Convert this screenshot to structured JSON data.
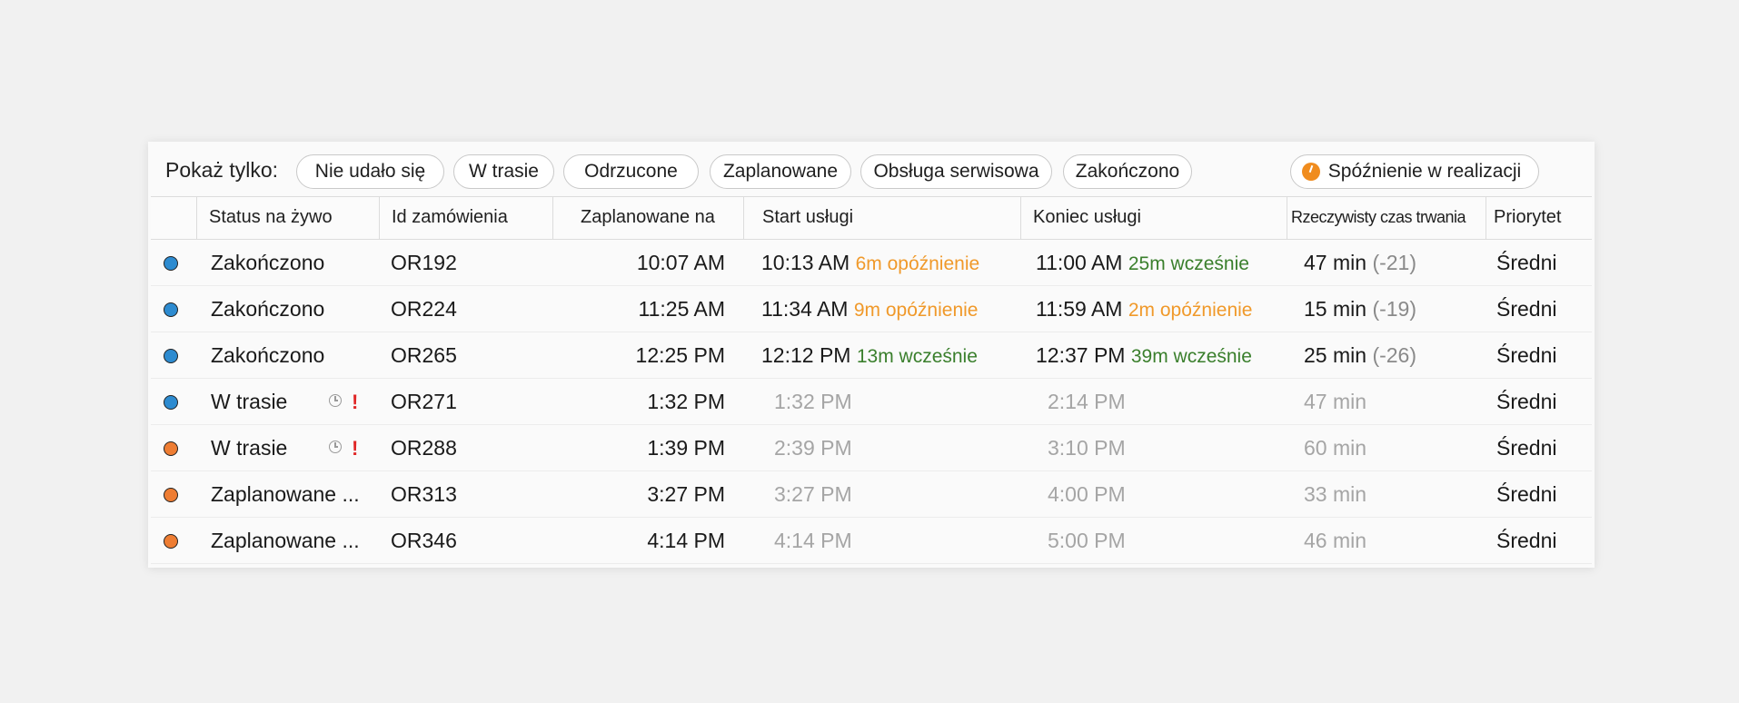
{
  "filters": {
    "label": "Pokaż tylko:",
    "chips": [
      "Nie udało się",
      "W trasie",
      "Odrzucone",
      "Zaplanowane",
      "Obsługa serwisowa",
      "Zakończono"
    ],
    "late_chip": "Spóźnienie w realizacji",
    "late_icon": "clock-late-icon",
    "late_color": "#f08c1e"
  },
  "columns": [
    "",
    "Status na żywo",
    "Id zamówienia",
    "Zaplanowane na",
    "Start usługi",
    "Koniec usługi",
    "Rzeczywisty czas trwania",
    "Priorytet"
  ],
  "colors": {
    "blue": "#2d8bd0",
    "orange": "#ee7d33",
    "late": "#f0992a",
    "early": "#3a7f2c",
    "muted": "#a5a5a5",
    "alert": "#e02626"
  },
  "rows": [
    {
      "dot": "blue",
      "status": "Zakończono",
      "id": "OR192",
      "scheduled": "10:07 AM",
      "start": "10:13 AM",
      "start_note": "6m opóźnienie",
      "end": "11:00 AM",
      "end_note": "25m wcześnie",
      "duration": "47 min",
      "delta": "(-21)",
      "priority": "Średni"
    },
    {
      "dot": "blue",
      "status": "Zakończono",
      "id": "OR224",
      "scheduled": "11:25 AM",
      "start": "11:34 AM",
      "start_note": "9m opóźnienie",
      "end": "11:59 AM",
      "end_note": "2m opóźnienie",
      "duration": "15 min",
      "delta": "(-19)",
      "priority": "Średni"
    },
    {
      "dot": "blue",
      "status": "Zakończono",
      "id": "OR265",
      "scheduled": "12:25 PM",
      "start": "12:12 PM",
      "start_note": "13m wcześnie",
      "end": "12:37 PM",
      "end_note": "39m wcześnie",
      "duration": "25 min",
      "delta": "(-26)",
      "priority": "Średni"
    },
    {
      "dot": "blue",
      "status": "W trasie",
      "id": "OR271",
      "scheduled": "1:32 PM",
      "start": "1:32 PM",
      "end": "2:14 PM",
      "duration": "47 min",
      "priority": "Średni",
      "alert": "!"
    },
    {
      "dot": "orange",
      "status": "W trasie",
      "id": "OR288",
      "scheduled": "1:39 PM",
      "start": "2:39 PM",
      "end": "3:10 PM",
      "duration": "60 min",
      "priority": "Średni",
      "alert": "!"
    },
    {
      "dot": "orange",
      "status": "Zaplanowane ...",
      "id": "OR313",
      "scheduled": "3:27 PM",
      "start": "3:27 PM",
      "end": "4:00 PM",
      "duration": "33 min",
      "priority": "Średni"
    },
    {
      "dot": "orange",
      "status": "Zaplanowane ...",
      "id": "OR346",
      "scheduled": "4:14 PM",
      "start": "4:14 PM",
      "end": "5:00 PM",
      "duration": "46 min",
      "priority": "Średni"
    }
  ]
}
